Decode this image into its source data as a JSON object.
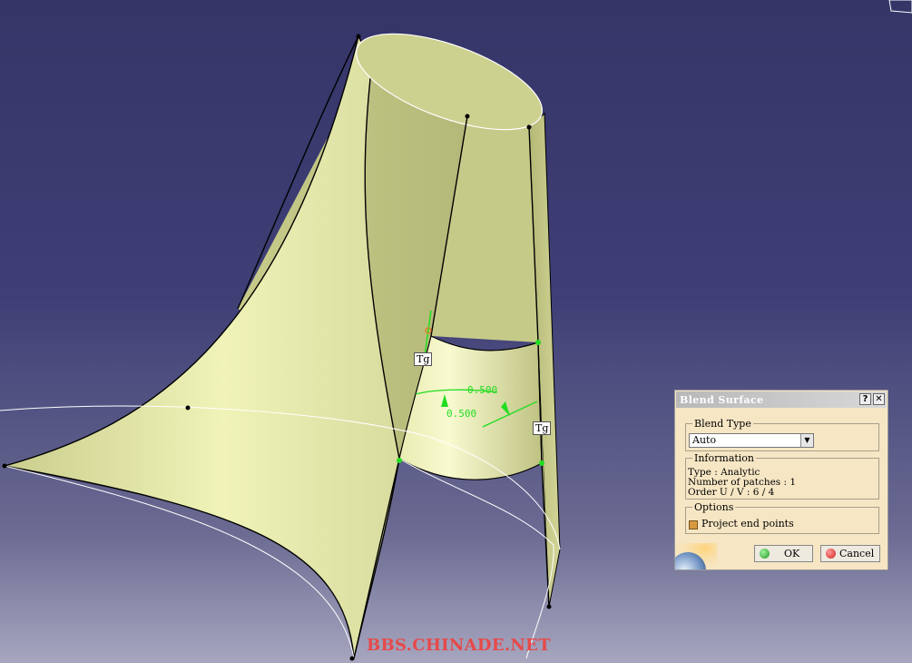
{
  "viewport": {
    "labels": {
      "tg_left": "Tg",
      "tg_right": "Tg",
      "dim_upper": "0.500",
      "dim_lower": "0.500"
    },
    "colors": {
      "surface_light": "#f0f3b8",
      "surface_mid": "#d5d99a",
      "surface_dark": "#a9ae6c",
      "edge": "#000000",
      "curve": "#ffffff",
      "dimension": "#22dd22"
    },
    "watermark": "BBS.CHINADE.NET"
  },
  "dialog": {
    "title": "Blend Surface",
    "help_label": "?",
    "close_label": "✕",
    "blend_type": {
      "legend": "Blend Type",
      "selected": "Auto"
    },
    "information": {
      "legend": "Information",
      "type_line": "Type : Analytic",
      "patches_line": "Number of patches : 1",
      "order_line": "Order U / V : 6 / 4"
    },
    "options": {
      "legend": "Options",
      "project_end_points_label": "Project end points",
      "project_end_points_checked": true
    },
    "ok_label": "OK",
    "cancel_label": "Cancel",
    "ok_color": "#1f9a1f",
    "cancel_color": "#d22020"
  }
}
